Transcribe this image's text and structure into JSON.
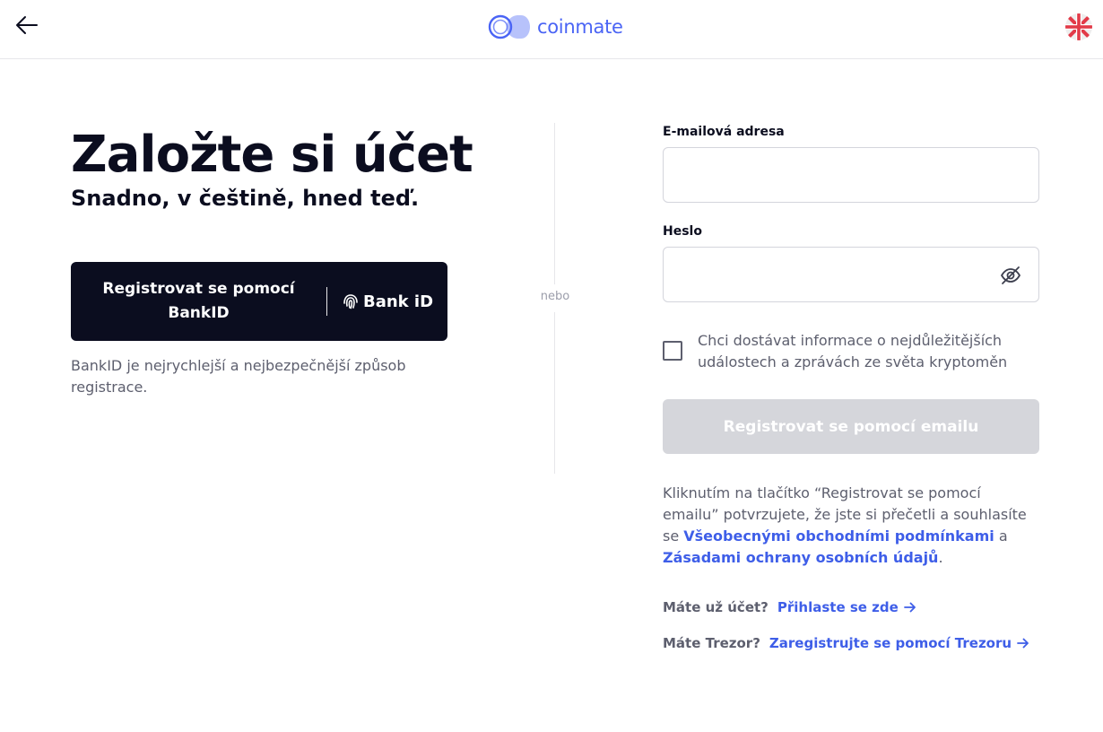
{
  "header": {
    "back_icon": "arrow-left-icon",
    "logo_text": "coinmate",
    "language_icon": "uk-flag-icon",
    "colors": {
      "brand": "#4a64f5"
    }
  },
  "hero": {
    "title": "Založte si účet",
    "subtitle": "Snadno, v češtině, hned teď."
  },
  "bankid": {
    "button_label": "Registrovat se pomocí BankID",
    "logo_text": "Bank iD",
    "note": "BankID je nejrychlejší a nejbezpečnější způsob registrace.",
    "colors": {
      "button_bg": "#0b0d1f"
    }
  },
  "divider": {
    "label": "nebo"
  },
  "form": {
    "email_label": "E-mailová adresa",
    "email_value": "",
    "password_label": "Heslo",
    "password_value": "",
    "password_toggle_icon": "eye-off-icon",
    "newsletter_label": "Chci dostávat informace o nejdůležitějších událostech a zprávách ze světa kryptoměn",
    "newsletter_checked": false,
    "submit_label": "Registrovat se pomocí emailu",
    "submit_disabled": true
  },
  "terms": {
    "text_before": "Kliknutím na tlačítko “Registrovat se pomocí emailu” potvrzujete, že jste si přečetli a souhlasíte se ",
    "link_terms": "Všeobecnými obchodními podmínkami",
    "conjunction": " a ",
    "link_privacy": "Zásadami ochrany osobních údajů",
    "text_after": "."
  },
  "alternatives": {
    "login_question": "Máte už účet?",
    "login_link": "Přihlaste se zde",
    "trezor_question": "Máte Trezor?",
    "trezor_link": "Zaregistrujte se pomocí Trezoru",
    "colors": {
      "link": "#3e5ee8"
    }
  }
}
